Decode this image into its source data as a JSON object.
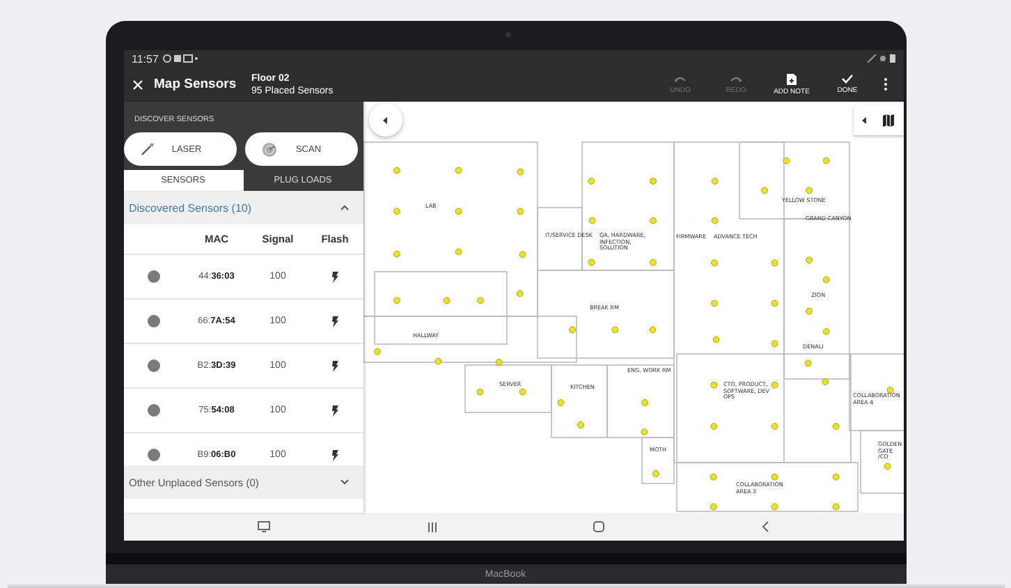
{
  "status_bar": {
    "time": "11:57"
  },
  "app_bar": {
    "title": "Map Sensors",
    "floor": "Floor 02",
    "placed": "95 Placed Sensors",
    "actions": [
      {
        "label": "UNDO",
        "kind": "undo",
        "disabled": true
      },
      {
        "label": "REDO",
        "kind": "redo",
        "disabled": true
      },
      {
        "label": "ADD NOTE",
        "kind": "note",
        "disabled": false
      },
      {
        "label": "DONE",
        "kind": "done",
        "disabled": false
      }
    ]
  },
  "discover": {
    "heading": "DISCOVER SENSORS",
    "buttons": [
      {
        "label": "LASER",
        "kind": "laser"
      },
      {
        "label": "SCAN",
        "kind": "scan"
      }
    ]
  },
  "tabs": [
    {
      "label": "SENSORS",
      "selected": true
    },
    {
      "label": "PLUG LOADS",
      "selected": false
    }
  ],
  "discovered": {
    "title": "Discovered Sensors (10)",
    "expanded": true,
    "columns": [
      "MAC",
      "Signal",
      "Flash"
    ],
    "rows": [
      {
        "mac": "44:**36:03**",
        "signal": "100"
      },
      {
        "mac": "66:**7A:54**",
        "signal": "100"
      },
      {
        "mac": "B2:**3D:39**",
        "signal": "100"
      },
      {
        "mac": "75:**54:08**",
        "signal": "100"
      },
      {
        "mac": "B9:**06:B0**",
        "signal": "100"
      }
    ]
  },
  "other": {
    "title": "Other Unplaced Sensors (0)",
    "expanded": false
  },
  "map": {
    "rooms": [
      {
        "label": "LAB"
      },
      {
        "label": "IT/SERVICE DESK"
      },
      {
        "label": "QA, HARDWARE, INFECTION, SOLUTION"
      },
      {
        "label": "FIRMWARE"
      },
      {
        "label": "ADVANCE TECH"
      },
      {
        "label": "YELLOW STONE"
      },
      {
        "label": "GRAND CANYON"
      },
      {
        "label": "ZION"
      },
      {
        "label": "DENALI"
      },
      {
        "label": "BREAK RM"
      },
      {
        "label": "HALLWAY"
      },
      {
        "label": "SERVER"
      },
      {
        "label": "KITCHEN"
      },
      {
        "label": "ENG. WORK RM"
      },
      {
        "label": "CTO, PRODUCT, SOFTWARE, DEV OPS"
      },
      {
        "label": "COLLABORATION AREA 4"
      },
      {
        "label": "MOTH"
      },
      {
        "label": "GOLDEN GATE /CO"
      },
      {
        "label": "COLLABORATION AREA 3"
      }
    ]
  },
  "device": {
    "label": "MacBook"
  }
}
